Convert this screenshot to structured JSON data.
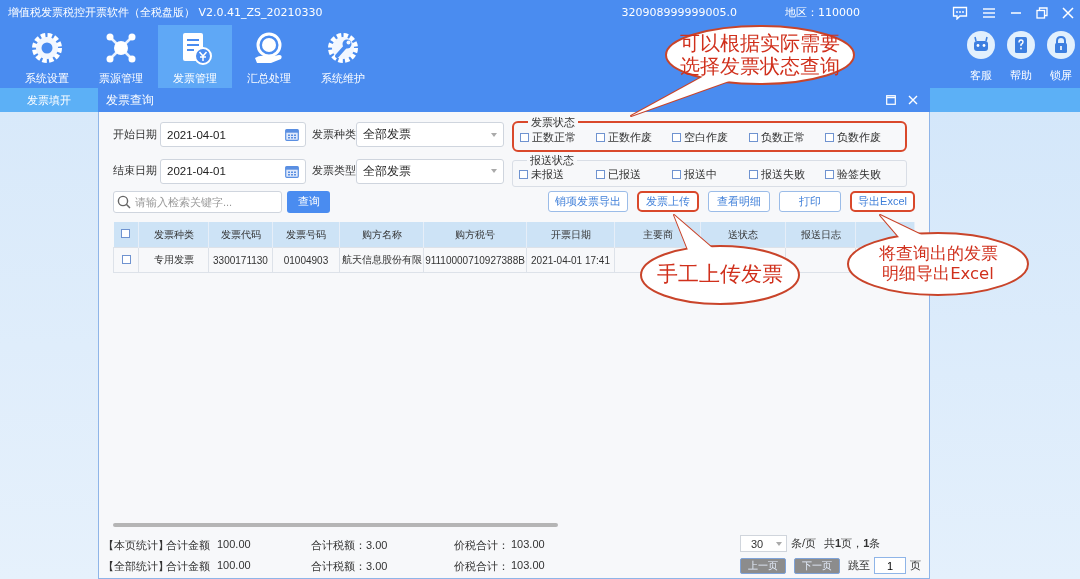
{
  "app": {
    "title": "增值税发票税控开票软件（全税盘版） V2.0.41_ZS_20210330",
    "tax_id": "320908999999005.0",
    "region": "地区：110000"
  },
  "tools": [
    {
      "label": "系统设置",
      "selected": false
    },
    {
      "label": "票源管理",
      "selected": false
    },
    {
      "label": "发票管理",
      "selected": true
    },
    {
      "label": "汇总处理",
      "selected": false
    },
    {
      "label": "系统维护",
      "selected": false
    }
  ],
  "side_tools": [
    {
      "label": "客服"
    },
    {
      "label": "帮助"
    },
    {
      "label": "锁屏"
    }
  ],
  "subnav": [
    {
      "label": "发票填开",
      "selected": true
    }
  ],
  "dialog": {
    "title": "发票查询",
    "date_fields": [
      {
        "label": "开始日期",
        "value": "2021-04-01"
      },
      {
        "label": "结束日期",
        "value": "2021-04-01"
      }
    ],
    "select_fields": [
      {
        "label": "发票种类",
        "value": "全部发票"
      },
      {
        "label": "发票类型",
        "value": "全部发票"
      }
    ],
    "status_groups": [
      {
        "legend": "发票状态",
        "highlighted": true,
        "options": [
          {
            "label": "正数正常",
            "checked": false
          },
          {
            "label": "正数作废",
            "checked": false
          },
          {
            "label": "空白作废",
            "checked": false
          },
          {
            "label": "负数正常",
            "checked": false
          },
          {
            "label": "负数作废",
            "checked": false
          }
        ]
      },
      {
        "legend": "报送状态",
        "highlighted": false,
        "options": [
          {
            "label": "未报送",
            "checked": false
          },
          {
            "label": "已报送",
            "checked": false
          },
          {
            "label": "报送中",
            "checked": false
          },
          {
            "label": "报送失败",
            "checked": false
          },
          {
            "label": "验签失败",
            "checked": false
          }
        ]
      }
    ],
    "search": {
      "placeholder": "请输入检索关键字...",
      "button": "查询"
    },
    "actions": [
      {
        "label": "销项发票导出",
        "highlighted": false
      },
      {
        "label": "发票上传",
        "highlighted": true
      },
      {
        "label": "查看明细",
        "highlighted": false
      },
      {
        "label": "打印",
        "highlighted": false
      },
      {
        "label": "导出Excel",
        "highlighted": true
      }
    ],
    "table": {
      "header_checked": false,
      "columns": [
        "发票种类",
        "发票代码",
        "发票号码",
        "购方名称",
        "购方税号",
        "开票日期",
        "主要商",
        "送状态",
        "报送日志"
      ],
      "rows": [
        {
          "checked": false,
          "cells": [
            "专用发票",
            "3300171130",
            "01004903",
            "航天信息股份有限",
            "91110000710927388B",
            "2021-04-01 17:41"
          ]
        }
      ]
    },
    "summary": [
      {
        "scope": "【本页统计】",
        "amount_label": "合计金额",
        "amount": "100.00",
        "tax": "合计税额：3.00",
        "total_label": "价税合计：",
        "total": "103.00"
      },
      {
        "scope": "【全部统计】",
        "amount_label": "合计金额",
        "amount": "100.00",
        "tax": "合计税额：3.00",
        "total_label": "价税合计：",
        "total": "103.00"
      }
    ],
    "pager": {
      "page_size": "30",
      "unit": "条/页",
      "totals": "共**1**页，**1**条",
      "prev": {
        "label": "上一页",
        "disabled": true
      },
      "next": {
        "label": "下一页",
        "disabled": true
      },
      "jump_label": "跳至",
      "page": "1",
      "page_suffix": "页"
    }
  },
  "annotations": [
    {
      "lines": [
        "可以根据实际需要",
        "选择发票状态查询"
      ]
    },
    {
      "lines": [
        "手工上传发票"
      ]
    },
    {
      "lines": [
        "将查询出的发票",
        "明细导出Excel"
      ]
    }
  ]
}
